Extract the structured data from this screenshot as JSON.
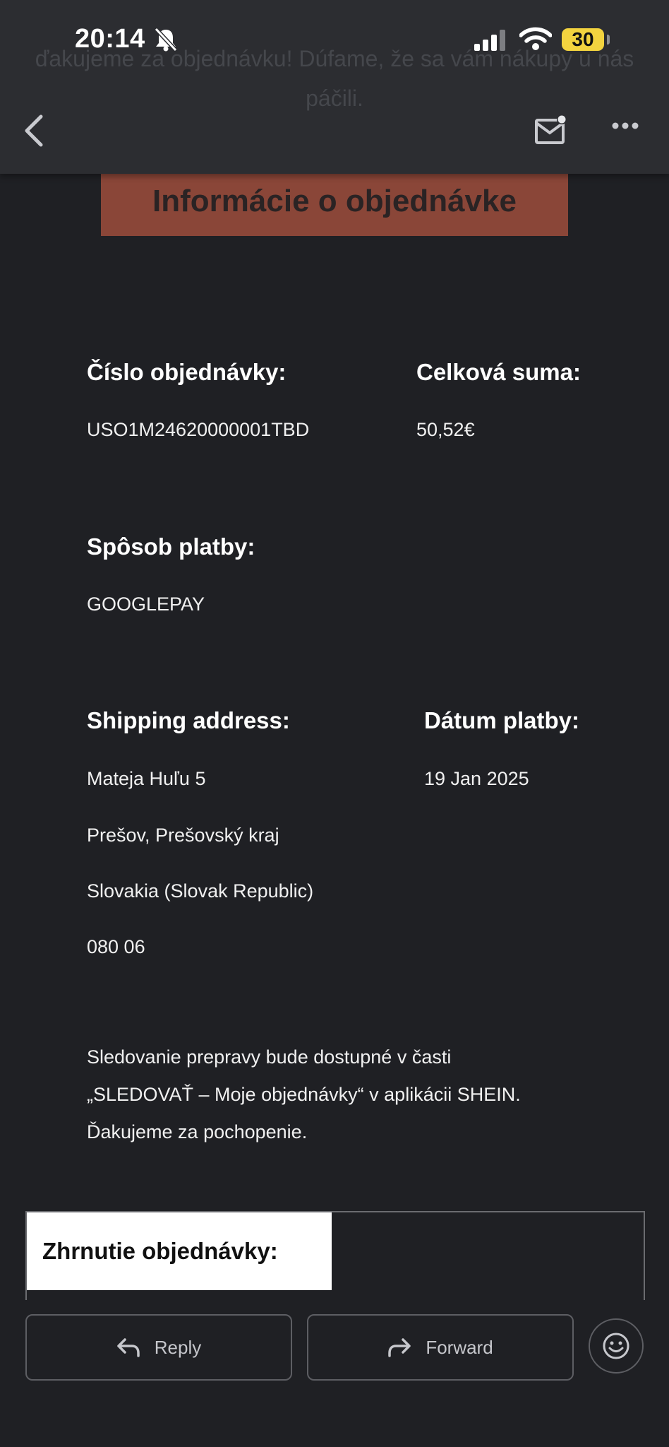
{
  "status_bar": {
    "time": "20:14",
    "battery": "30"
  },
  "header_behind": {
    "line1": "ďakujeme za objednávku! Dúfame, že sa vám nákupy u nás",
    "line2": "páčili."
  },
  "banner_title": "Informácie o objednávke",
  "order": {
    "number_label": "Číslo objednávky:",
    "number_value": "USO1M24620000001TBD",
    "total_label": "Celková suma:",
    "total_value": "50,52€",
    "payment_label": "Spôsob platby:",
    "payment_value": "GOOGLEPAY",
    "shipping_label": "Shipping address:",
    "address_lines": [
      "Mateja Huľu 5",
      "Prešov, Prešovský kraj",
      "Slovakia (Slovak Republic)",
      "080 06"
    ],
    "date_label": "Dátum platby:",
    "date_value": "19 Jan 2025"
  },
  "tracking_note": {
    "line1": "Sledovanie prepravy bude dostupné v časti",
    "line2": "„SLEDOVAŤ – Moje objednávky“ v aplikácii SHEIN.",
    "line3": "Ďakujeme za pochopenie."
  },
  "summary_title": "Zhrnutie objednávky:",
  "actions": {
    "reply": "Reply",
    "forward": "Forward"
  },
  "icons": {
    "back": "chevron-left-icon",
    "mail": "mail-unread-icon",
    "more": "more-horizontal-icon",
    "reply": "reply-arrow-icon",
    "forward": "forward-arrow-icon",
    "emoji": "smiley-icon"
  },
  "colors": {
    "background": "#1f2024",
    "banner": "#8a4638",
    "battery": "#f3d33f"
  }
}
